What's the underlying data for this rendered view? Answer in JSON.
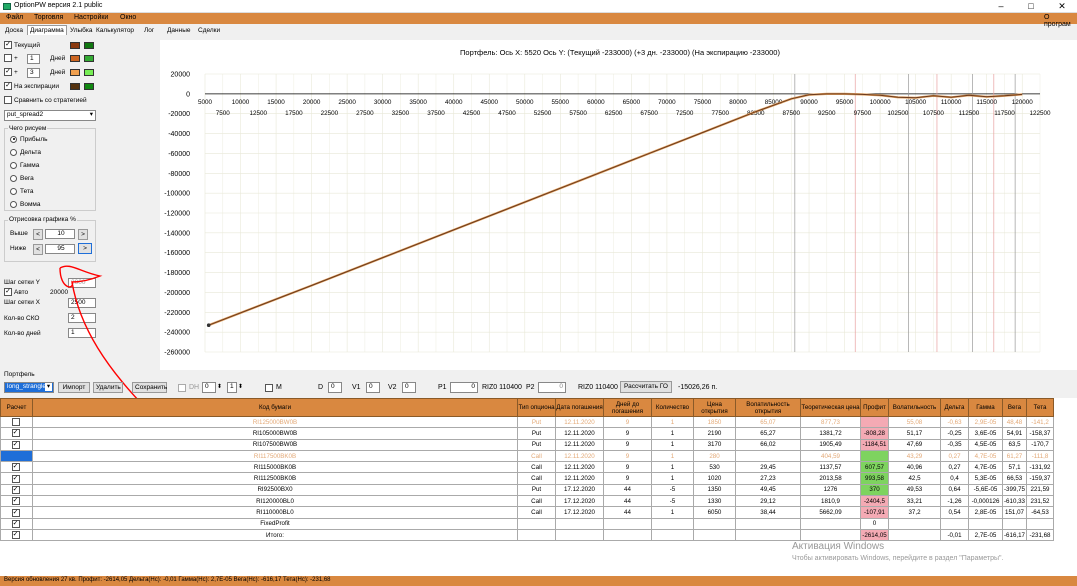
{
  "window": {
    "title": "OptionPW версия 2.1 public"
  },
  "menu": [
    "Файл",
    "Торговля",
    "Настройки",
    "Окно"
  ],
  "menu_right": "О програм",
  "tabs": [
    "Доска",
    "Диаграмма",
    "Улыбка",
    "Калькулятор",
    "Лог",
    "Данные",
    "Сделки"
  ],
  "active_tab": 1,
  "left": {
    "current_label": "Текущий",
    "plus": "+",
    "days1": "1",
    "days2": "3",
    "days_label": "Дней",
    "expiry_label": "На экспирации",
    "compare_label": "Сравнить со стратегией",
    "strategy": "put_spread2",
    "what_draw": "Чего рисуем",
    "options": [
      "Прибыль",
      "Дельта",
      "Гамма",
      "Вега",
      "Тета",
      "Вомма"
    ],
    "render_pct": "Отрисовка графика %",
    "above_label": "Выше",
    "above_val": "10",
    "below_label": "Ниже",
    "below_val": "95",
    "grid_y_label": "Шаг сетки Y",
    "grid_y_val": "2000",
    "auto_label": "Авто",
    "auto_val": "20000",
    "grid_x_label": "Шаг сетки X",
    "grid_x_val": "2500",
    "sko_label": "Кол-во СКО",
    "sko_val": "2",
    "days_count_label": "Кол-во дней",
    "days_count_val": "1",
    "colors": {
      "current1": "#8a3a10",
      "current2": "#117711",
      "d1a": "#cc6622",
      "d1b": "#33aa33",
      "d2a": "#f0a050",
      "d2b": "#77ee55",
      "exp1": "#553311",
      "exp2": "#118811"
    }
  },
  "chart_data": {
    "type": "line",
    "title": "Портфель: Ось X: 5520 Ось Y:  (Текущий -233000)  (+3 дн. -233000)  (На экспирацию -233000)",
    "x_ticks_top": [
      "5000",
      "10000",
      "15000",
      "20000",
      "25000",
      "30000",
      "35000",
      "40000",
      "45000",
      "50000",
      "55000",
      "60000",
      "65000",
      "70000",
      "75000",
      "80000",
      "85000",
      "90000",
      "95000",
      "100000",
      "105000",
      "110000",
      "115000",
      "120000"
    ],
    "x_ticks_bottom": [
      "7500",
      "12500",
      "17500",
      "22500",
      "27500",
      "32500",
      "37500",
      "42500",
      "47500",
      "52500",
      "57500",
      "62500",
      "67500",
      "72500",
      "77500",
      "82500",
      "87500",
      "92500",
      "97500",
      "102500",
      "107500",
      "112500",
      "117500",
      "122500"
    ],
    "y_ticks": [
      "20000",
      "0",
      "-20000",
      "-40000",
      "-60000",
      "-80000",
      "-100000",
      "-120000",
      "-140000",
      "-160000",
      "-180000",
      "-200000",
      "-220000",
      "-240000",
      "-260000"
    ],
    "xlim": [
      5000,
      122500
    ],
    "ylim": [
      -260000,
      20000
    ],
    "series": [
      {
        "x": [
          5520,
          20000,
          40000,
          60000,
          75000,
          82500,
          87500,
          90000,
          92500,
          95000,
          97500,
          100000,
          102500,
          105000,
          107500,
          110000,
          112500,
          115000,
          117500,
          120000
        ],
        "y": [
          -233000,
          -193000,
          -137000,
          -81000,
          -39000,
          -18000,
          -5000,
          -1000,
          0,
          0,
          -500,
          -1500,
          -3500,
          -4000,
          -2000,
          -3500,
          -1500,
          -3000,
          -2000,
          -500
        ]
      }
    ],
    "vlines": [
      88000,
      96500,
      104000,
      108000,
      113000,
      116000,
      119000
    ],
    "colors": {
      "line": "#6b3a1c",
      "alt": "#e0a060",
      "grid": "#e8e8d8"
    }
  },
  "portfolio": {
    "label": "Портфель",
    "selected": "long_strangle",
    "import": "Импорт",
    "delete": "Удалить",
    "save": "Сохранить",
    "dh": "DH",
    "dh_val": "0",
    "dh_val2": "1",
    "m": "M",
    "d": "D",
    "d_val": "0",
    "v1": "V1",
    "v1_val": "0",
    "v2": "V2",
    "v2_val": "0",
    "p1": "P1",
    "p1_val": "0",
    "riz1": "RIZ0 110400",
    "p2": "P2",
    "p2_val": "0",
    "riz2": "RIZ0 110400",
    "go_btn": "Рассчитать ГО",
    "go_val": "-15026,26 п."
  },
  "table": {
    "headers": [
      "Расчет",
      "Код бумаги",
      "Тип опциона",
      "Дата погашения",
      "Дней до погашения",
      "Количество",
      "Цена открытия",
      "Волатильность открытия",
      "Теоретическая цена",
      "Профит",
      "Волатильность",
      "Дельта",
      "Гамма",
      "Вега",
      "Тета"
    ],
    "rows": [
      {
        "chk": false,
        "dim": true,
        "c": [
          "RI125000BW0B",
          "Put",
          "12.11.2020",
          "9",
          "1",
          "1850",
          "65,07",
          "877,73",
          "",
          "55,08",
          "-0,63",
          "2,9E-05",
          "48,48",
          "-141,2"
        ]
      },
      {
        "chk": true,
        "dim": false,
        "c": [
          "RI105000BW0B",
          "Put",
          "12.11.2020",
          "9",
          "1",
          "2190",
          "65,27",
          "1381,72",
          "-808,28",
          "51,17",
          "-0,25",
          "3,6E-05",
          "54,91",
          "-158,37"
        ]
      },
      {
        "chk": true,
        "dim": false,
        "c": [
          "RI107500BW0B",
          "Put",
          "12.11.2020",
          "9",
          "1",
          "3170",
          "66,02",
          "1905,49",
          "-1184,51",
          "47,69",
          "-0,35",
          "4,5E-05",
          "63,5",
          "-170,7"
        ]
      },
      {
        "chk": false,
        "dim": true,
        "sel": true,
        "c": [
          "RI117500BK0B",
          "Call",
          "12.11.2020",
          "9",
          "1",
          "280",
          "",
          "404,59",
          "",
          "43,29",
          "0,27",
          "4,7E-05",
          "61,27",
          "-111,8"
        ]
      },
      {
        "chk": true,
        "dim": false,
        "c": [
          "RI115000BK0B",
          "Call",
          "12.11.2020",
          "9",
          "1",
          "530",
          "29,45",
          "1137,57",
          "607,57",
          "40,96",
          "0,27",
          "4,7E-05",
          "57,1",
          "-131,92"
        ]
      },
      {
        "chk": true,
        "dim": false,
        "c": [
          "RI112500BK0B",
          "Call",
          "12.11.2020",
          "9",
          "1",
          "1020",
          "27,23",
          "2013,58",
          "993,58",
          "42,5",
          "0,4",
          "5,3E-05",
          "66,53",
          "-159,37"
        ]
      },
      {
        "chk": true,
        "dim": false,
        "c": [
          "RI92500BX0",
          "Put",
          "17.12.2020",
          "44",
          "-5",
          "1350",
          "49,45",
          "1276",
          "370",
          "49,53",
          "0,64",
          "-5,6E-05",
          "-399,75",
          "221,59"
        ]
      },
      {
        "chk": true,
        "dim": false,
        "c": [
          "RI120000BL0",
          "Call",
          "17.12.2020",
          "44",
          "-5",
          "1330",
          "29,12",
          "1810,9",
          "-2404,5",
          "33,21",
          "-1,26",
          "-0,000126",
          "-610,33",
          "231,52"
        ]
      },
      {
        "chk": true,
        "dim": false,
        "c": [
          "RI110000BL0",
          "Call",
          "17.12.2020",
          "44",
          "1",
          "6050",
          "38,44",
          "5662,09",
          "-107,91",
          "37,2",
          "0,54",
          "2,8E-05",
          "151,07",
          "-64,53"
        ]
      },
      {
        "chk": true,
        "dim": false,
        "c": [
          "FixedProfit",
          "",
          "",
          "",
          "",
          "",
          "",
          "",
          "0",
          "",
          "",
          "",
          "",
          ""
        ]
      },
      {
        "chk": true,
        "dim": false,
        "c": [
          "Итого:",
          "",
          "",
          "",
          "",
          "",
          "",
          "",
          "-2614,05",
          "",
          "-0,01",
          "2,7E-05",
          "-616,17",
          "-231,68"
        ]
      }
    ]
  },
  "watermark": {
    "line1": "Активация Windows",
    "line2": "Чтобы активировать Windows, перейдите в раздел \"Параметры\"."
  },
  "status": "Версия обновления 27 кв. Профит: -2614,05 Дельта(Нс): -0,01 Гамма(Нс): 2,7E-05 Вега(Нс): -616,17 Тета(Нс): -231,68"
}
